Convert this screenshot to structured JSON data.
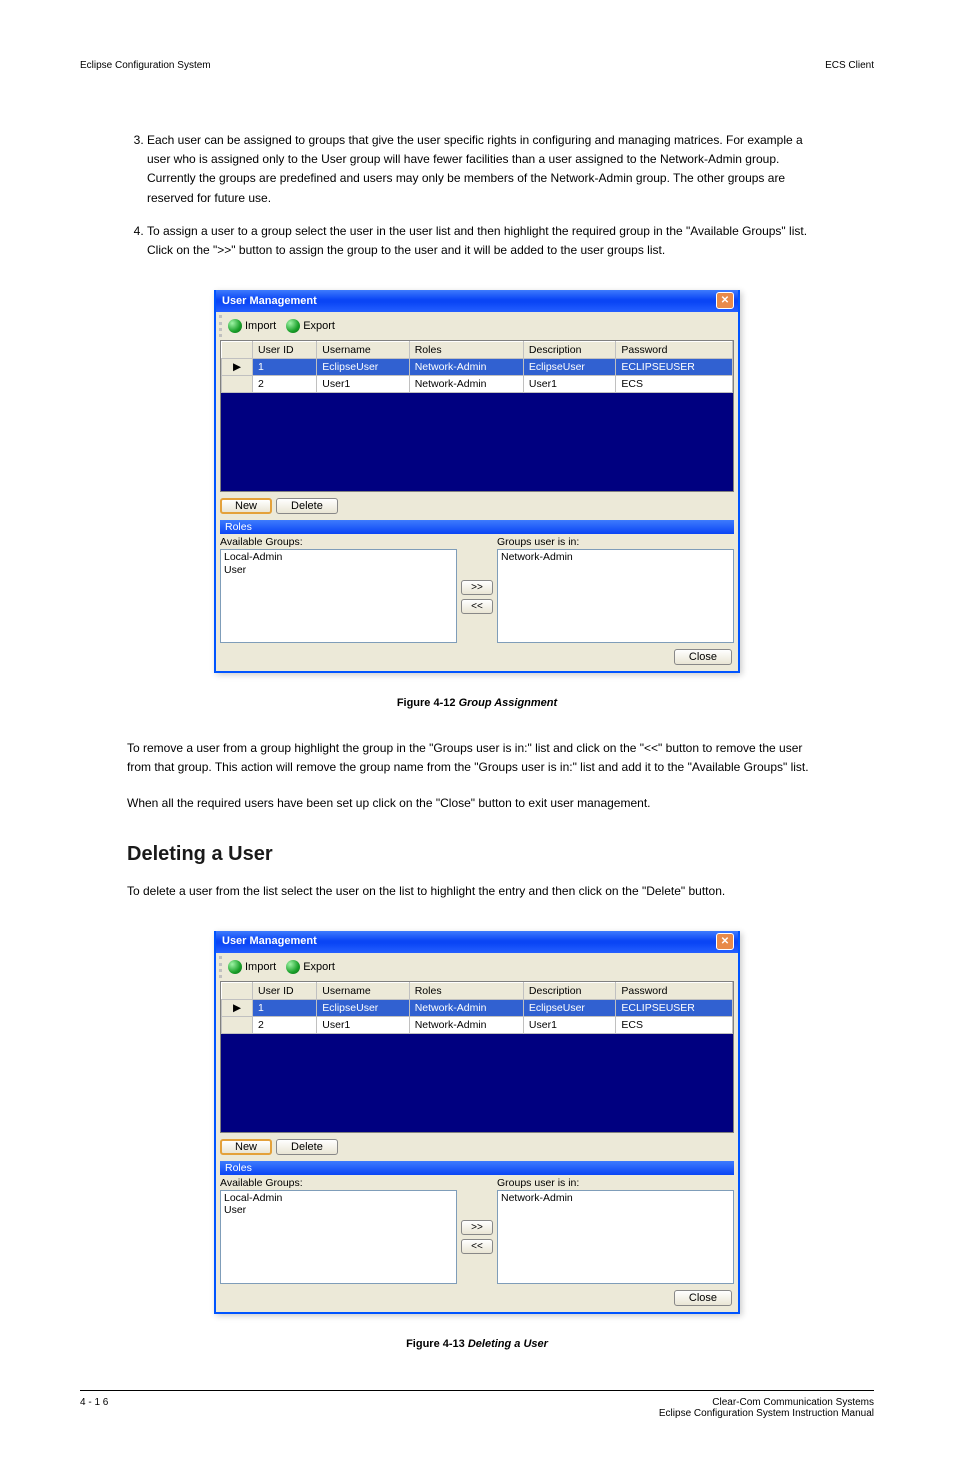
{
  "header": {
    "left": "Eclipse Configuration System",
    "right": "ECS Client"
  },
  "intro_steps": [
    "Each user can be assigned to groups that give the user specific rights in configuring and managing matrices. For example a user who is assigned only to the User group will have fewer facilities than a user assigned to the Network-Admin group. Currently the groups are predefined and users may only be members of the Network-Admin group. The other groups are reserved for future use.",
    "To assign a user to a group select the user in the user list and then highlight the required group in the \"Available Groups\" list. Click on the \">>\" button to assign the group to the user and it will be added to the user groups list."
  ],
  "dialog": {
    "title": "User Management",
    "toolbar": {
      "import": "Import",
      "export": "Export"
    },
    "columns": [
      "User ID",
      "Username",
      "Roles",
      "Description",
      "Password"
    ],
    "rows": [
      {
        "selected": true,
        "indicator": "▶",
        "cells": [
          "1",
          "EclipseUser",
          "Network-Admin",
          "EclipseUser",
          "ECLIPSEUSER"
        ]
      },
      {
        "selected": false,
        "indicator": "",
        "cells": [
          "2",
          "User1",
          "Network-Admin",
          "User1",
          "ECS"
        ]
      }
    ],
    "buttons": {
      "new": "New",
      "delete": "Delete"
    },
    "roles": {
      "header": "Roles",
      "available_label": "Available Groups:",
      "available": [
        "Local-Admin",
        "User"
      ],
      "assigned_label": "Groups user is in:",
      "assigned": [
        "Network-Admin"
      ],
      "add": ">>",
      "remove": "<<"
    },
    "close": "Close"
  },
  "figure": {
    "num": "Figure 4-12",
    "caption": "Group Assignment"
  },
  "after_text": [
    "To remove a user from a group highlight the group in the \"Groups user is in:\" list and click on the \"<<\" button to remove the user from that group. This action will remove the group name from the \"Groups user is in:\" list and add it to the \"Available Groups\" list.",
    "When all the required users have been set up click on the \"Close\" button to exit user management."
  ],
  "section": {
    "title": "Deleting a User",
    "text": "To delete a user from the list select the user on the list to highlight the entry and then click on the \"Delete\" button.",
    "figure": {
      "num": "Figure 4-13",
      "caption": "Deleting a User"
    }
  },
  "footer": {
    "left": "4 - 1 6",
    "right": "Clear-Com Communication Systems\nEclipse Configuration System Instruction Manual"
  }
}
